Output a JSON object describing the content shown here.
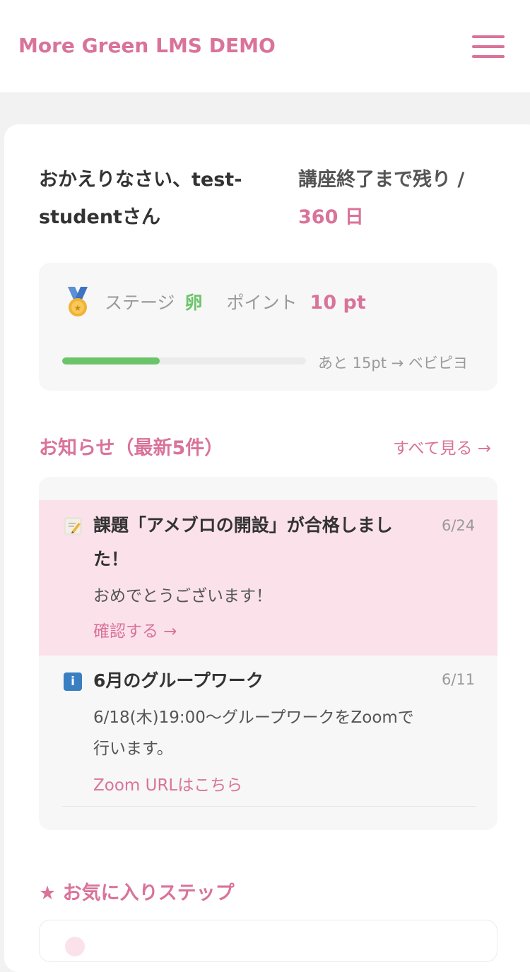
{
  "header": {
    "brand": "More Green LMS DEMO",
    "menu_icon": "hamburger-menu-icon"
  },
  "welcome": {
    "greeting": "おかえりなさい、test-studentさん",
    "remaining_label": "講座終了まで残り /",
    "remaining_days": "360 日"
  },
  "stage": {
    "medal_icon": "medal-icon",
    "stage_label": "ステージ",
    "stage_value": "卵",
    "points_label": "ポイント",
    "points_value": "10 pt",
    "progress_percent": 40,
    "progress_note": "あと 15pt → ベビピヨ"
  },
  "news": {
    "section_title": "お知らせ（最新5件）",
    "see_all": "すべて見る →",
    "items": [
      {
        "icon": "memo-icon",
        "title": "課題「アメブロの開設」が合格しました！",
        "date": "6/24",
        "body": "おめでとうございます！",
        "link": "確認する →"
      },
      {
        "icon": "info-icon",
        "title": "6月のグループワーク",
        "date": "6/11",
        "body": "6/18(木)19:00〜グループワークをZoomで行います。",
        "link": "Zoom URLはこちら"
      }
    ]
  },
  "favorites": {
    "section_title": "★ お気に入りステップ"
  },
  "colors": {
    "accent": "#d9739a",
    "success": "#6cc46a",
    "highlight": "#fbe2ea"
  }
}
